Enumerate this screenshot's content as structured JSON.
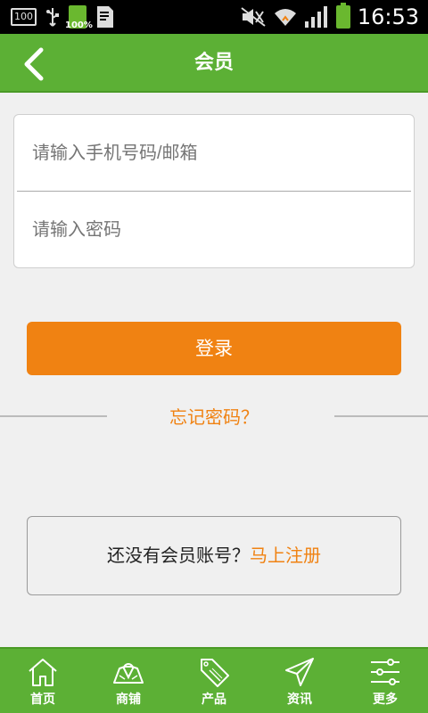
{
  "status_bar": {
    "notif_box": "100",
    "battery_small_pct": "100%",
    "time": "16:53"
  },
  "header": {
    "title": "会员"
  },
  "form": {
    "phone_placeholder": "请输入手机号码/邮箱",
    "password_placeholder": "请输入密码"
  },
  "login_label": "登录",
  "forgot_label": "忘记密码？",
  "register": {
    "prompt": "还没有会员账号？",
    "link": "马上注册"
  },
  "nav": {
    "items": [
      {
        "label": "首页",
        "icon": "home-icon"
      },
      {
        "label": "商铺",
        "icon": "map-shop-icon"
      },
      {
        "label": "产品",
        "icon": "sale-tag-icon"
      },
      {
        "label": "资讯",
        "icon": "paper-plane-icon"
      },
      {
        "label": "更多",
        "icon": "sliders-icon"
      }
    ]
  },
  "colors": {
    "primary_green": "#5cb035",
    "accent_orange": "#f08212"
  }
}
